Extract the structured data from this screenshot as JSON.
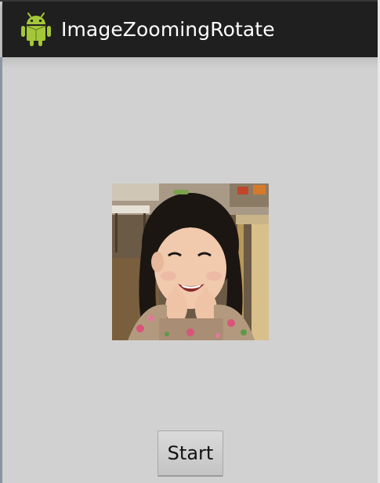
{
  "action_bar": {
    "title": "ImageZoomingRotate",
    "icon": "android-robot-icon"
  },
  "content": {
    "image": "photo-girl-smiling"
  },
  "controls": {
    "start_label": "Start"
  },
  "colors": {
    "action_bar_bg": "#1f1f1f",
    "content_bg": "#d1d1d1",
    "android_green": "#a4c639"
  }
}
